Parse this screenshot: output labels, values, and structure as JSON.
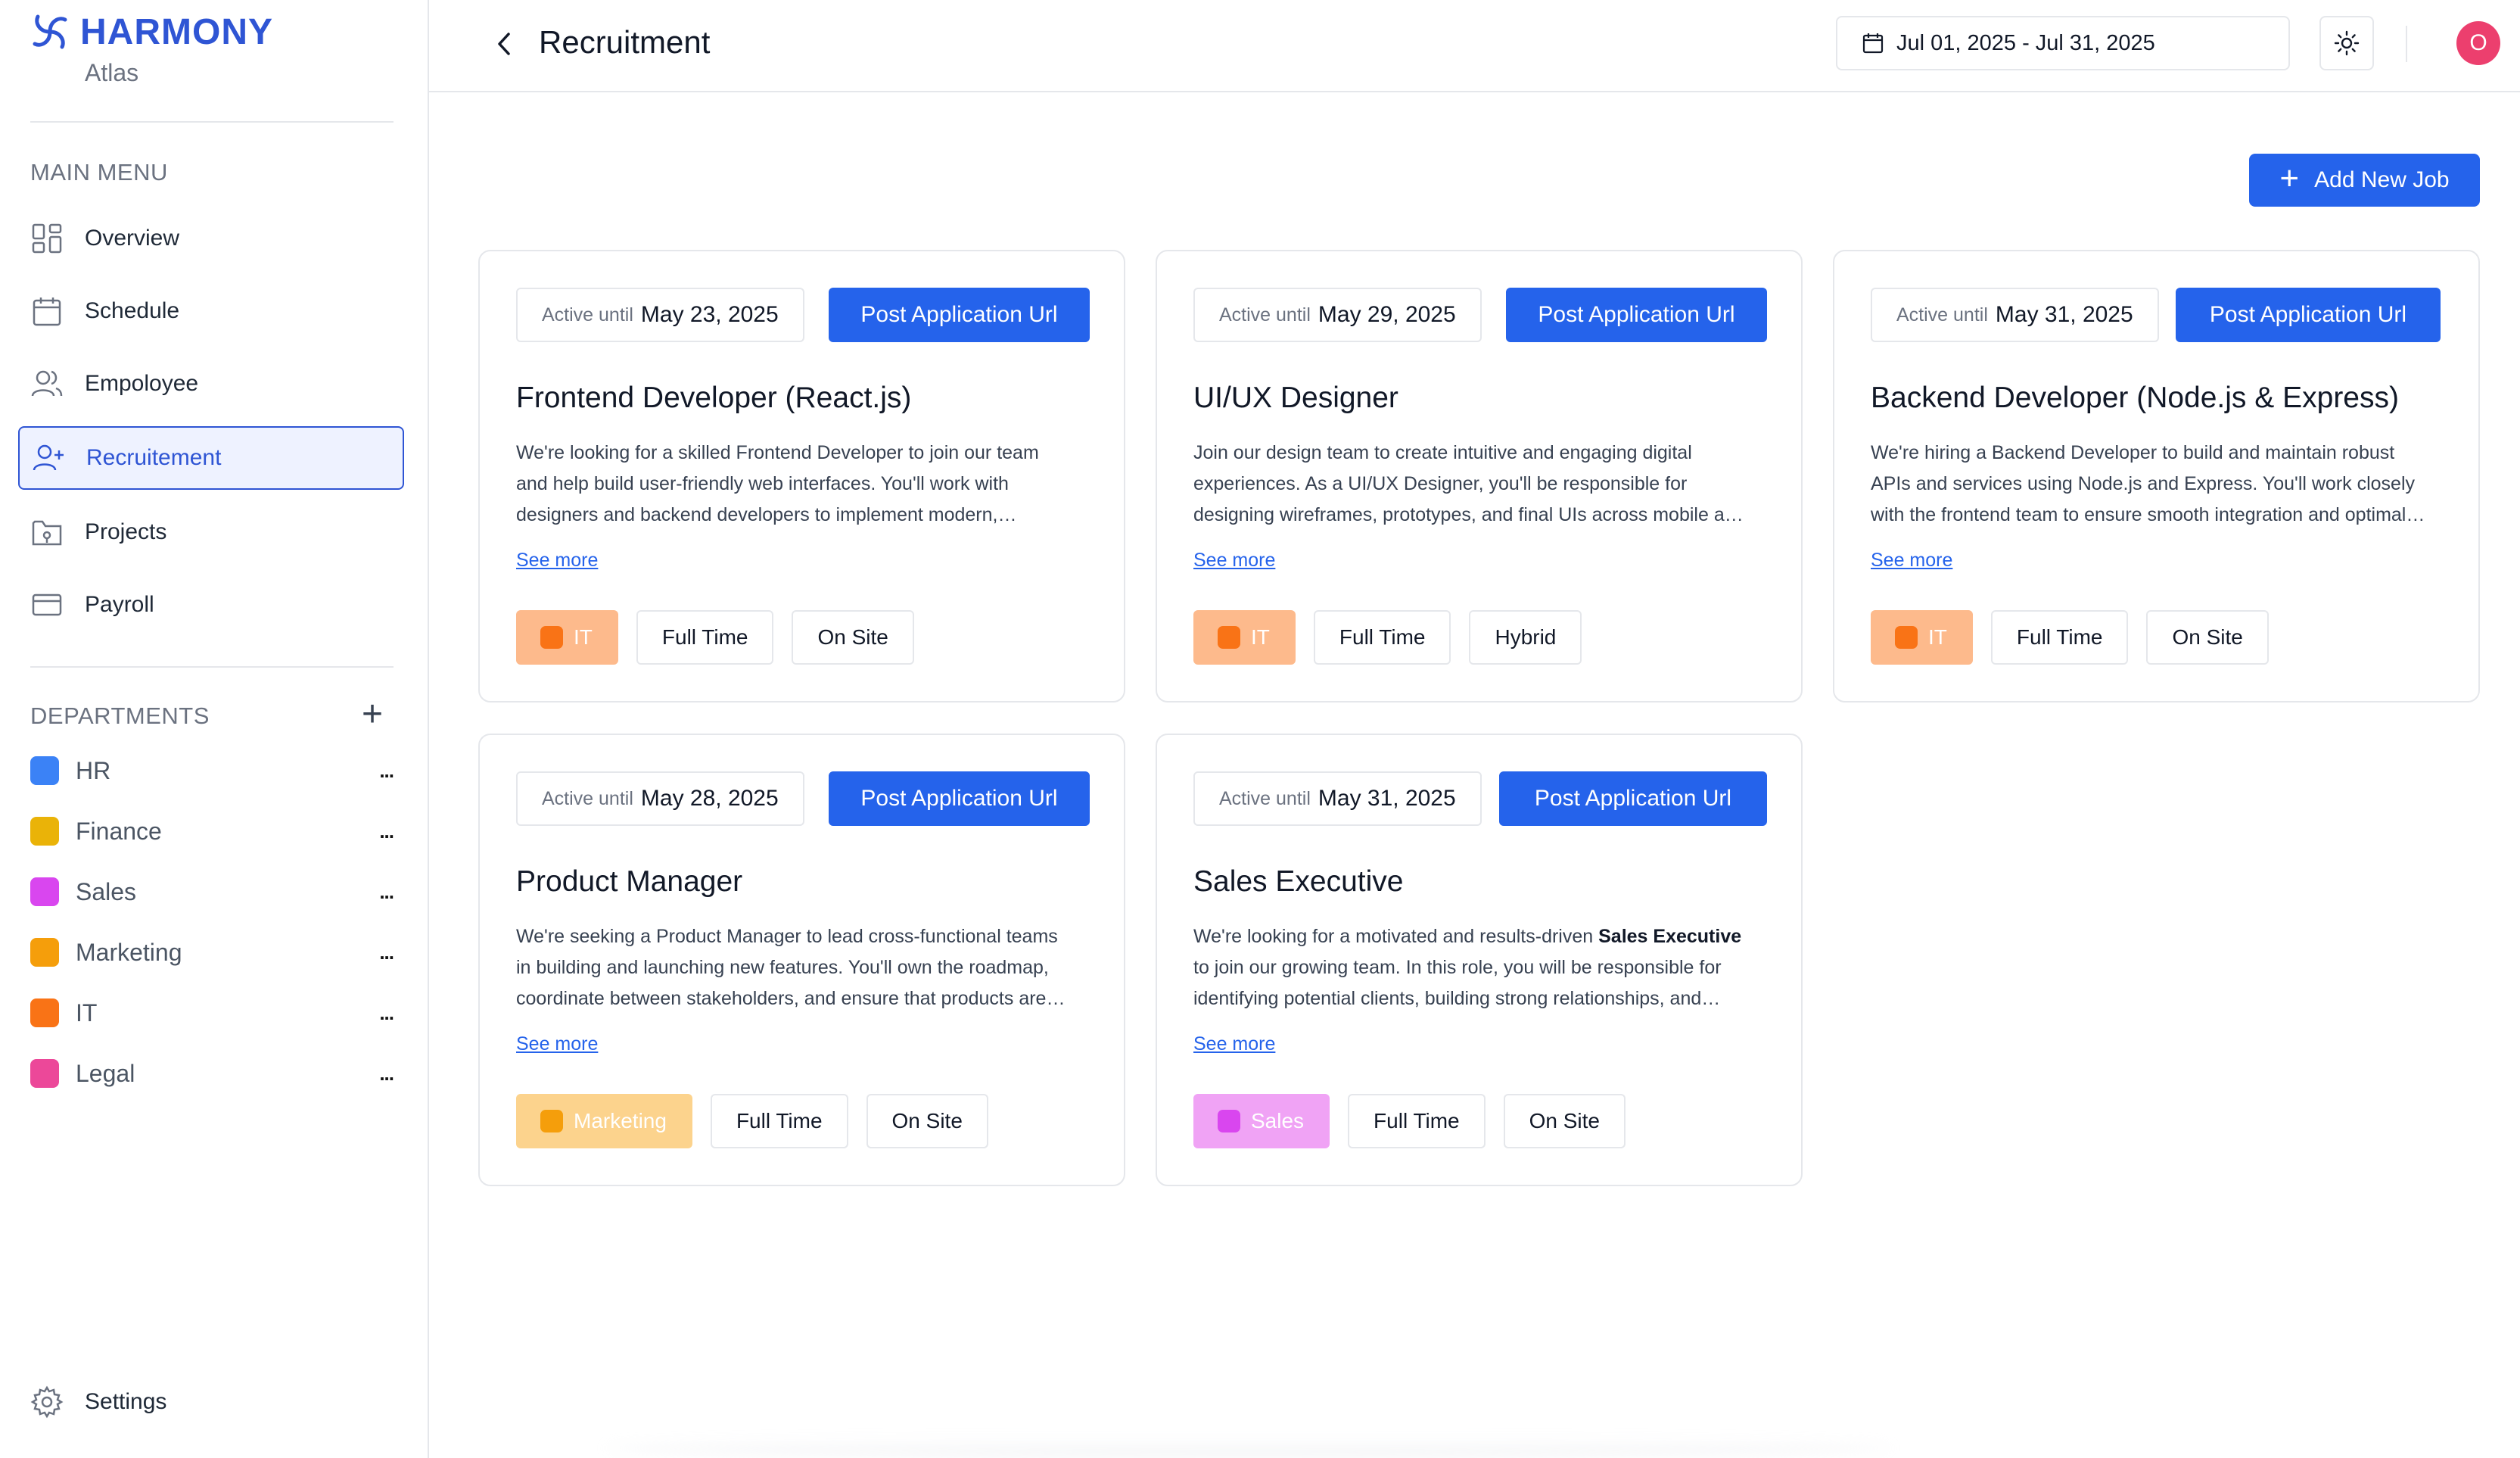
{
  "brand": {
    "title": "HARMONY",
    "subtitle": "Atlas"
  },
  "sidebar": {
    "main_menu_label": "MAIN MENU",
    "items": [
      {
        "label": "Overview",
        "icon": "grid-icon"
      },
      {
        "label": "Schedule",
        "icon": "calendar-icon"
      },
      {
        "label": "Empoloyee",
        "icon": "users-icon"
      },
      {
        "label": "Recruitement",
        "icon": "user-plus-icon",
        "active": true
      },
      {
        "label": "Projects",
        "icon": "folder-icon"
      },
      {
        "label": "Payroll",
        "icon": "credit-card-icon"
      }
    ],
    "departments_label": "DEPARTMENTS",
    "departments": [
      {
        "name": "HR",
        "color": "#3b82f6",
        "more": "..."
      },
      {
        "name": "Finance",
        "color": "#eab308",
        "more": "..."
      },
      {
        "name": "Sales",
        "color": "#d946ef",
        "more": "..."
      },
      {
        "name": "Marketing",
        "color": "#f59e0b",
        "more": "..."
      },
      {
        "name": "IT",
        "color": "#f97316",
        "more": "..."
      },
      {
        "name": "Legal",
        "color": "#ec4899",
        "more": "..."
      }
    ],
    "settings_label": "Settings"
  },
  "header": {
    "title": "Recruitment",
    "date_range": "Jul 01, 2025 - Jul 31, 2025",
    "avatar_initial": "O"
  },
  "main": {
    "add_job_label": "Add New Job",
    "active_until_label": "Active until",
    "post_url_label": "Post Application Url",
    "see_more_label": "See more",
    "jobs": [
      {
        "active_date": "May 23, 2025",
        "title": "Frontend Developer (React.js)",
        "description_lines": [
          "We're looking for a skilled Frontend Developer to join our team",
          "and help build user-friendly web interfaces. You'll work with",
          "designers and backend developers to implement modern,…"
        ],
        "department": "IT",
        "department_color": "#fdba8c",
        "dot_color": "#f97316",
        "employment": "Full Time",
        "location": "On Site"
      },
      {
        "active_date": "May 29, 2025",
        "title": "UI/UX Designer",
        "description_lines": [
          "Join our design team to create intuitive and engaging digital",
          "experiences. As a UI/UX Designer, you'll be responsible for",
          "designing wireframes, prototypes, and final UIs across mobile a…"
        ],
        "department": "IT",
        "department_color": "#fdba8c",
        "dot_color": "#f97316",
        "employment": "Full Time",
        "location": "Hybrid"
      },
      {
        "active_date": "May 31, 2025",
        "title": "Backend Developer (Node.js & Express)",
        "description_lines": [
          "We're hiring a Backend Developer to build and maintain robust",
          "APIs and services using Node.js and Express. You'll work closely",
          "with the frontend team to ensure smooth integration and optimal…"
        ],
        "department": "IT",
        "department_color": "#fdba8c",
        "dot_color": "#f97316",
        "employment": "Full Time",
        "location": "On Site"
      },
      {
        "active_date": "May 28, 2025",
        "title": "Product Manager",
        "description_lines": [
          "We're seeking a Product Manager to lead cross-functional teams",
          "in building and launching new features. You'll own the roadmap,",
          "coordinate between stakeholders, and ensure that products are…"
        ],
        "department": "Marketing",
        "department_color": "#fcd38d",
        "dot_color": "#f59e0b",
        "employment": "Full Time",
        "location": "On Site"
      },
      {
        "active_date": "May 31, 2025",
        "title": "Sales Executive",
        "description_lines": [
          "We're looking for a motivated and results-driven |Sales Executive|",
          "to join our growing team. In this role, you will be responsible for",
          "identifying potential clients, building strong relationships, and…"
        ],
        "department": "Sales",
        "department_color": "#f0a3f5",
        "dot_color": "#d946ef",
        "employment": "Full Time",
        "location": "On Site"
      }
    ]
  }
}
